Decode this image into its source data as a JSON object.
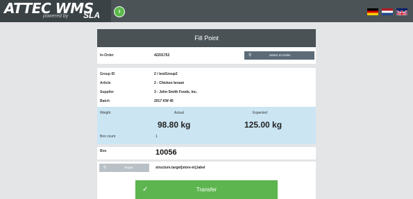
{
  "header": {
    "logo": "ATTEC WMS",
    "logo_sub": "powered by",
    "logo_sla": "SLA",
    "nav_icon": "chevron-right-icon",
    "flags": [
      "flag-germany",
      "flag-netherlands",
      "flag-uk"
    ]
  },
  "panel": {
    "title": "Fill Point"
  },
  "in_order": {
    "label": "In-Order",
    "value": "42201752",
    "button": "Select In-Order"
  },
  "info": {
    "group_id_label": "Group ID",
    "group_id_value": "2 / testGroup2",
    "article_label": "Article",
    "article_value": "2 - Chicken breast",
    "supplier_label": "Supplier",
    "supplier_value": "3 - John Smith Foods, Inc.",
    "batch_label": "Batch",
    "batch_value": "2017 KW 45"
  },
  "weight": {
    "label": "Weight",
    "actual_label": "Actual",
    "expected_label": "Expected",
    "actual_value": "98.80 kg",
    "expected_value": "125.00 kg",
    "box_count_label": "Box count",
    "box_count_value": "1"
  },
  "box": {
    "label": "Box",
    "value": "10056"
  },
  "target": {
    "button": "Target",
    "value": "structure.target[store-in].label"
  },
  "transfer": {
    "label": "Transfer"
  },
  "colors": {
    "topbar": "#4c5357",
    "header": "#4a5256",
    "accent_green": "#5db54f",
    "weight_band": "#cbe5f3"
  }
}
